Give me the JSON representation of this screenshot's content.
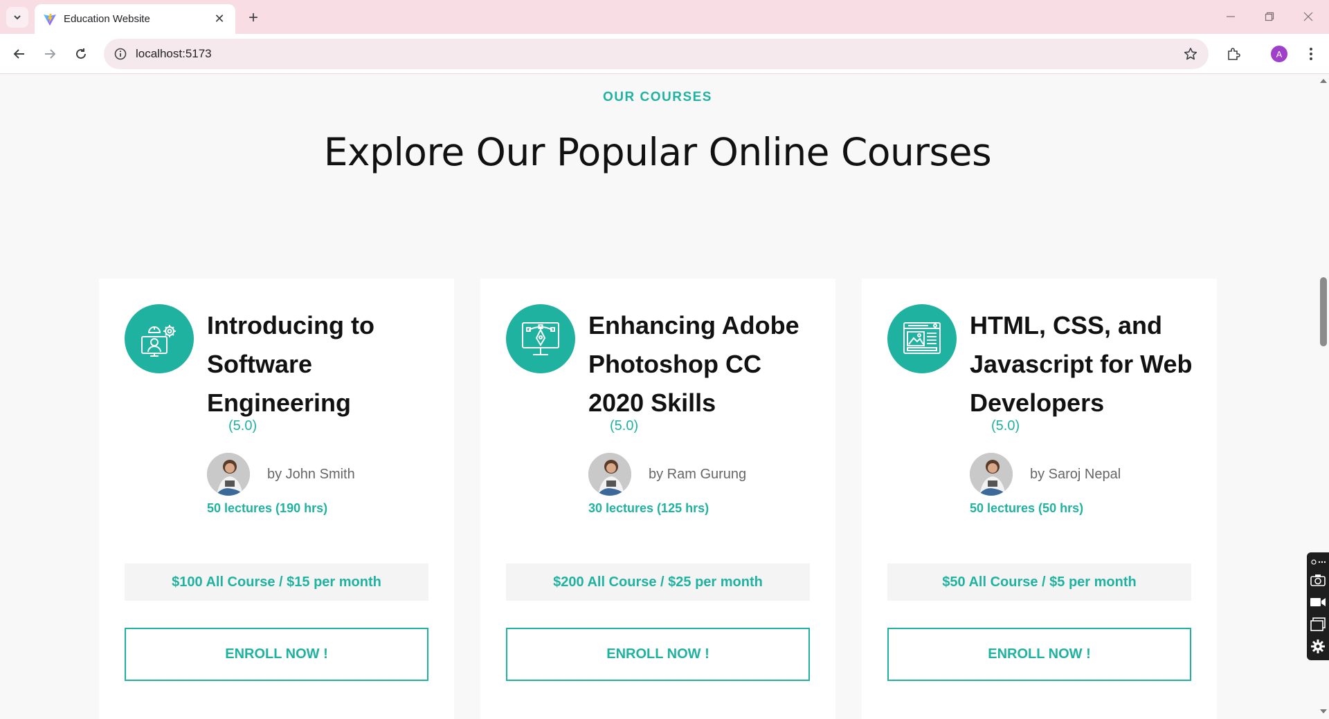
{
  "browser": {
    "tab_title": "Education Website",
    "url": "localhost:5173",
    "profile_initial": "A",
    "icons": [
      "tab-search-icon",
      "close-icon",
      "plus-icon",
      "minimize-icon",
      "restore-icon",
      "close-window-icon",
      "back-arrow-icon",
      "forward-arrow-icon",
      "reload-icon",
      "info-icon",
      "star-icon",
      "extensions-icon",
      "kebab-menu-icon"
    ]
  },
  "section": {
    "subtitle": "OUR COURSES",
    "title": "Explore Our Popular Online Courses"
  },
  "courses": [
    {
      "icon": "engineer-gear-icon",
      "title": "Introducing to Software Engineering",
      "rating": "(5.0)",
      "author": "by John Smith",
      "lectures": "50 lectures (190 hrs)",
      "price": "$100 All Course / $15 per month",
      "enroll_label": "ENROLL NOW !"
    },
    {
      "icon": "design-monitor-icon",
      "title": "Enhancing Adobe Photoshop CC 2020 Skills",
      "rating": "(5.0)",
      "author": "by Ram Gurung",
      "lectures": "30 lectures (125 hrs)",
      "price": "$200 All Course / $25 per month",
      "enroll_label": "ENROLL NOW !"
    },
    {
      "icon": "web-layout-icon",
      "title": "HTML, CSS, and Javascript for Web Developers",
      "rating": "(5.0)",
      "author": "by Saroj Nepal",
      "lectures": "50 lectures (50 hrs)",
      "price": "$50 All Course / $5 per month",
      "enroll_label": "ENROLL NOW !"
    }
  ],
  "colors": {
    "accent": "#1fb2a0",
    "tabbar": "#f8dde5",
    "page_bg": "#f8f8f8"
  }
}
